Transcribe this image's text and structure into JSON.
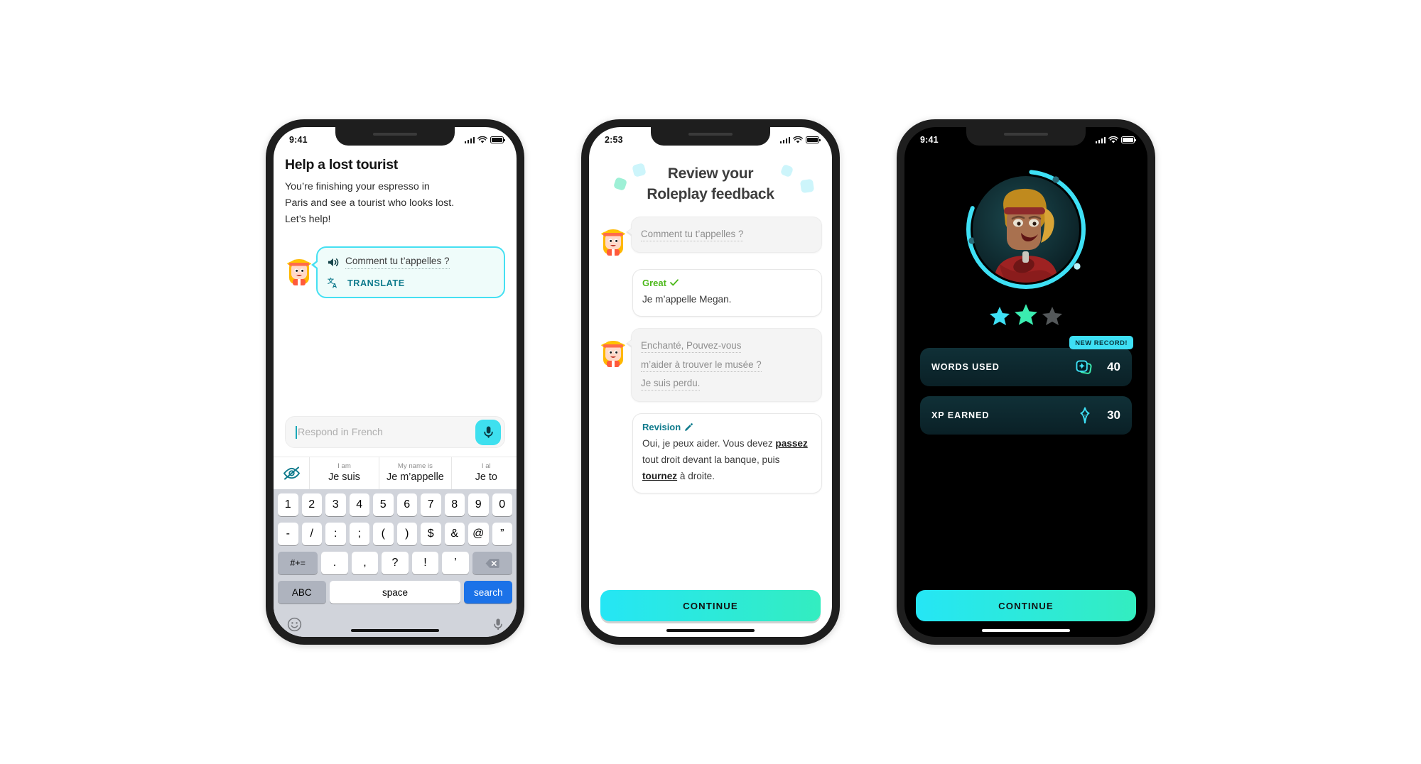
{
  "screen1": {
    "status": {
      "time": "9:41",
      "signal_icon": "cellular-bars-icon",
      "wifi_icon": "wifi-icon",
      "battery_icon": "battery-icon"
    },
    "title": "Help a lost tourist",
    "prompt_lines": [
      "You’re finishing your espresso in",
      "Paris and see a tourist who looks lost.",
      "Let’s help!"
    ],
    "bubble": {
      "speaker_icon": "speaker-icon",
      "text": "Comment tu t’appelles ?",
      "translate_icon": "translate-icon",
      "translate_label": "TRANSLATE"
    },
    "input": {
      "placeholder": "Respond in French",
      "mic_icon": "microphone-icon"
    },
    "suggestions": {
      "hide_icon": "eye-off-icon",
      "chips": [
        {
          "en": "I am",
          "fr": "Je suis"
        },
        {
          "en": "My name is",
          "fr": "Je m’appelle"
        },
        {
          "en": "I al",
          "fr": "Je to"
        }
      ]
    },
    "keyboard": {
      "row1": [
        "1",
        "2",
        "3",
        "4",
        "5",
        "6",
        "7",
        "8",
        "9",
        "0"
      ],
      "row2": [
        "-",
        "/",
        ":",
        ";",
        "(",
        ")",
        "$",
        "&",
        "@",
        "”"
      ],
      "row3": [
        "#+=",
        ".",
        ",",
        "?",
        "!",
        "’"
      ],
      "backspace_icon": "backspace-icon",
      "abc_label": "ABC",
      "space_label": "space",
      "search_label": "search",
      "emoji_icon": "emoji-icon",
      "dictation_icon": "microphone-icon"
    }
  },
  "screen2": {
    "status": {
      "time": "2:53"
    },
    "title_line1": "Review your",
    "title_line2": "Roleplay feedback",
    "messages": [
      {
        "type": "prompt",
        "avatar_icon": "character-avatar-icon",
        "lines": [
          "Comment tu t’appelles ?"
        ]
      },
      {
        "type": "feedback",
        "heading": "Great",
        "heading_icon": "check-icon",
        "body": "Je m’appelle Megan."
      },
      {
        "type": "prompt",
        "avatar_icon": "character-avatar-icon",
        "lines": [
          "Enchanté, Pouvez-vous",
          "m’aider à trouver le musée ?",
          "Je suis perdu."
        ]
      },
      {
        "type": "revision",
        "heading": "Revision",
        "heading_icon": "pencil-icon",
        "body_html": "Oui, je peux aider. Vous devez <b>passez</b> tout droit devant la banque, puis <b>tournez</b> à droite."
      }
    ],
    "cta_label": "CONTINUE"
  },
  "screen3": {
    "status": {
      "time": "9:41"
    },
    "avatar_icon": "character-portrait-icon",
    "stars": {
      "filled": 2,
      "total": 3
    },
    "badge": "NEW RECORD!",
    "stats": [
      {
        "label": "WORDS USED",
        "value": "40",
        "icon": "word-cards-icon"
      },
      {
        "label": "XP EARNED",
        "value": "30",
        "icon": "xp-bolt-icon"
      }
    ],
    "cta_label": "CONTINUE"
  },
  "colors": {
    "accent_cyan": "#3ee0f5",
    "accent_mint": "#33edc0",
    "teal_text": "#0e7a8c",
    "green": "#4cb81a",
    "dark_bg": "#000000"
  }
}
